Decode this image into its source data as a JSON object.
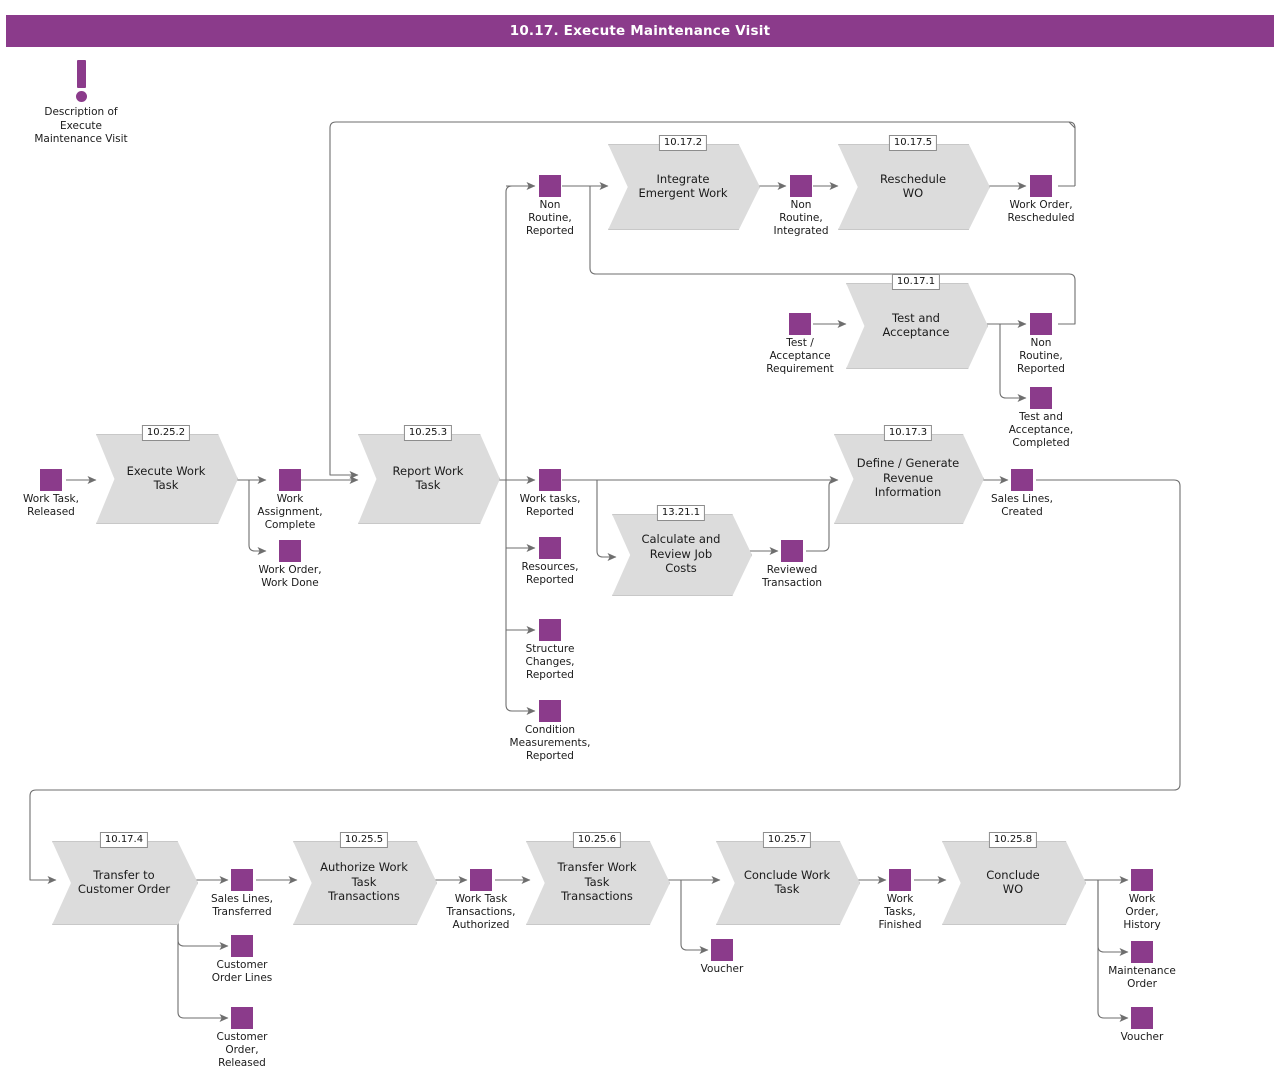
{
  "header": {
    "title": "10.17. Execute Maintenance Visit",
    "bar_color": "#8B3B8B"
  },
  "note": {
    "icon": "exclamation-icon",
    "label": "Description of\nExecute\nMaintenance Visit",
    "line1": "Description of",
    "line2": "Execute",
    "line3": "Maintenance Visit"
  },
  "colors": {
    "accent_purple": "#8B3B8B",
    "process_fill": "#DCDCDC",
    "process_stroke": "#C8C8C8",
    "connector": "#6E6E6E",
    "text": "#1A1A1A"
  },
  "processes": [
    {
      "id": "integrate-emergent-work",
      "number": "10.17.2",
      "label": "Integrate\nEmergent Work",
      "l1": "Integrate",
      "l2": "Emergent Work",
      "l3": ""
    },
    {
      "id": "reschedule-wo",
      "number": "10.17.5",
      "label": "Reschedule\nWO",
      "l1": "Reschedule",
      "l2": "WO",
      "l3": ""
    },
    {
      "id": "test-and-acceptance",
      "number": "10.17.1",
      "label": "Test and\nAcceptance",
      "l1": "Test and",
      "l2": "Acceptance",
      "l3": ""
    },
    {
      "id": "execute-work-task",
      "number": "10.25.2",
      "label": "Execute Work\nTask",
      "l1": "Execute Work",
      "l2": "Task",
      "l3": ""
    },
    {
      "id": "report-work-task",
      "number": "10.25.3",
      "label": "Report Work\nTask",
      "l1": "Report Work",
      "l2": "Task",
      "l3": ""
    },
    {
      "id": "calculate-review-job-costs",
      "number": "13.21.1",
      "label": "Calculate and\nReview Job\nCosts",
      "l1": "Calculate and",
      "l2": "Review Job",
      "l3": "Costs"
    },
    {
      "id": "define-generate-revenue-information",
      "number": "10.17.3",
      "label": "Define / Generate\nRevenue\nInformation",
      "l1": "Define / Generate",
      "l2": "Revenue",
      "l3": "Information"
    },
    {
      "id": "transfer-to-customer-order",
      "number": "10.17.4",
      "label": "Transfer to\nCustomer Order",
      "l1": "Transfer to",
      "l2": "Customer Order",
      "l3": ""
    },
    {
      "id": "authorize-work-task-transactions",
      "number": "10.25.5",
      "label": "Authorize Work\nTask\nTransactions",
      "l1": "Authorize Work",
      "l2": "Task",
      "l3": "Transactions"
    },
    {
      "id": "transfer-work-task-transactions",
      "number": "10.25.6",
      "label": "Transfer Work\nTask\nTransactions",
      "l1": "Transfer Work",
      "l2": "Task",
      "l3": "Transactions"
    },
    {
      "id": "conclude-work-task",
      "number": "10.25.7",
      "label": "Conclude Work\nTask",
      "l1": "Conclude Work",
      "l2": "Task",
      "l3": ""
    },
    {
      "id": "conclude-wo",
      "number": "10.25.8",
      "label": "Conclude\nWO",
      "l1": "Conclude",
      "l2": "WO",
      "l3": ""
    }
  ],
  "states": [
    {
      "id": "non-routine-reported-top",
      "label": "Non\nRoutine,\nReported",
      "l1": "Non",
      "l2": "Routine,",
      "l3": "Reported"
    },
    {
      "id": "non-routine-integrated",
      "label": "Non\nRoutine,\nIntegrated",
      "l1": "Non",
      "l2": "Routine,",
      "l3": "Integrated"
    },
    {
      "id": "work-order-rescheduled",
      "label": "Work Order,\nRescheduled",
      "l1": "Work Order,",
      "l2": "Rescheduled",
      "l3": ""
    },
    {
      "id": "test-acceptance-requirement",
      "label": "Test /\nAcceptance\nRequirement",
      "l1": "Test /",
      "l2": "Acceptance",
      "l3": "Requirement"
    },
    {
      "id": "non-routine-reported-mid",
      "label": "Non\nRoutine,\nReported",
      "l1": "Non",
      "l2": "Routine,",
      "l3": "Reported"
    },
    {
      "id": "test-and-acceptance-completed",
      "label": "Test and\nAcceptance,\nCompleted",
      "l1": "Test and",
      "l2": "Acceptance,",
      "l3": "Completed"
    },
    {
      "id": "work-task-released",
      "label": "Work Task,\nReleased",
      "l1": "Work Task,",
      "l2": "Released",
      "l3": ""
    },
    {
      "id": "work-assignment-complete",
      "label": "Work\nAssignment,\nComplete",
      "l1": "Work",
      "l2": "Assignment,",
      "l3": "Complete"
    },
    {
      "id": "work-order-work-done",
      "label": "Work Order,\nWork Done",
      "l1": "Work Order,",
      "l2": "Work Done",
      "l3": ""
    },
    {
      "id": "work-tasks-reported",
      "label": "Work tasks,\nReported",
      "l1": "Work tasks,",
      "l2": "Reported",
      "l3": ""
    },
    {
      "id": "resources-reported",
      "label": "Resources,\nReported",
      "l1": "Resources,",
      "l2": "Reported",
      "l3": ""
    },
    {
      "id": "structure-changes-reported",
      "label": "Structure\nChanges,\nReported",
      "l1": "Structure",
      "l2": "Changes,",
      "l3": "Reported"
    },
    {
      "id": "condition-measurements-reported",
      "label": "Condition\nMeasurements,\nReported",
      "l1": "Condition",
      "l2": "Measurements,",
      "l3": "Reported"
    },
    {
      "id": "reviewed-transaction",
      "label": "Reviewed\nTransaction",
      "l1": "Reviewed",
      "l2": "Transaction",
      "l3": ""
    },
    {
      "id": "sales-lines-created",
      "label": "Sales Lines,\nCreated",
      "l1": "Sales Lines,",
      "l2": "Created",
      "l3": ""
    },
    {
      "id": "sales-lines-transferred",
      "label": "Sales Lines,\nTransferred",
      "l1": "Sales Lines,",
      "l2": "Transferred",
      "l3": ""
    },
    {
      "id": "customer-order-lines",
      "label": "Customer\nOrder Lines",
      "l1": "Customer",
      "l2": "Order Lines",
      "l3": ""
    },
    {
      "id": "customer-order-released",
      "label": "Customer\nOrder,\nReleased",
      "l1": "Customer",
      "l2": "Order,",
      "l3": "Released"
    },
    {
      "id": "work-task-transactions-authorized",
      "label": "Work Task\nTransactions,\nAuthorized",
      "l1": "Work Task",
      "l2": "Transactions,",
      "l3": "Authorized"
    },
    {
      "id": "voucher-mid",
      "label": "Voucher",
      "l1": "Voucher",
      "l2": "",
      "l3": ""
    },
    {
      "id": "work-tasks-finished",
      "label": "Work\nTasks,\nFinished",
      "l1": "Work",
      "l2": "Tasks,",
      "l3": "Finished"
    },
    {
      "id": "work-order-history",
      "label": "Work\nOrder,\nHistory",
      "l1": "Work",
      "l2": "Order,",
      "l3": "History"
    },
    {
      "id": "maintenance-order",
      "label": "Maintenance\nOrder",
      "l1": "Maintenance",
      "l2": "Order",
      "l3": ""
    },
    {
      "id": "voucher-end",
      "label": "Voucher",
      "l1": "Voucher",
      "l2": "",
      "l3": ""
    }
  ]
}
